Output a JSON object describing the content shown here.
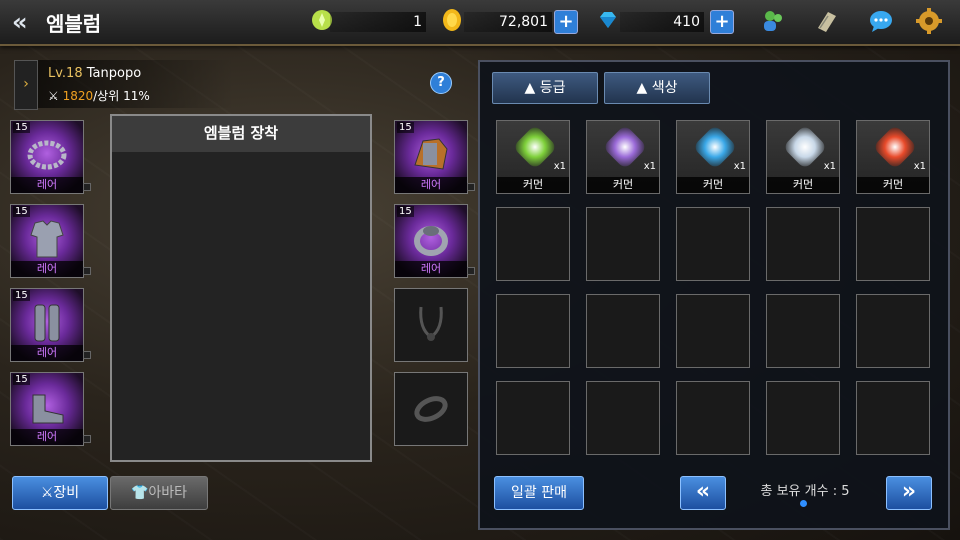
{
  "header": {
    "title": "엠블럼",
    "stamina_value": "1",
    "gold_value": "72,801",
    "gem_value": "410"
  },
  "character": {
    "level": "Lv.18",
    "name": "Tanpopo",
    "power": "1820",
    "rank": "/상위 11%"
  },
  "equipment": {
    "left_slots": [
      {
        "level": "15",
        "grade": "레어",
        "item": "necklace-chain"
      },
      {
        "level": "15",
        "grade": "레어",
        "item": "chest-armor"
      },
      {
        "level": "15",
        "grade": "레어",
        "item": "leg-armor"
      },
      {
        "level": "15",
        "grade": "레어",
        "item": "boots"
      }
    ],
    "right_slots": [
      {
        "level": "15",
        "grade": "레어",
        "item": "gauntlet"
      },
      {
        "level": "15",
        "grade": "레어",
        "item": "ring"
      },
      {
        "level": "",
        "grade": "",
        "item": "empty-necklace"
      },
      {
        "level": "",
        "grade": "",
        "item": "empty-ring"
      }
    ]
  },
  "emblem_panel": {
    "title": "엠블럼 장착"
  },
  "tabs": {
    "equip_label": "장비",
    "avatar_label": "아바타"
  },
  "inventory": {
    "filter_grade": "▲ 등급",
    "filter_color": "▲ 색상",
    "items": [
      {
        "grade": "커먼",
        "qty": "x1",
        "color": "#7ed03a"
      },
      {
        "grade": "커먼",
        "qty": "x1",
        "color": "#9a6ad8"
      },
      {
        "grade": "커먼",
        "qty": "x1",
        "color": "#3aa8e8"
      },
      {
        "grade": "커먼",
        "qty": "x1",
        "color": "#c8d8e8"
      },
      {
        "grade": "커먼",
        "qty": "x1",
        "color": "#e84a2a"
      }
    ],
    "sell_all_label": "일괄 판매",
    "total_count_label": "총 보유 개수 : 5",
    "prev_label": "«",
    "next_label": "»"
  },
  "colors": {
    "rare": "#d07aff",
    "button_blue": "#2f7fd8",
    "gold": "#f0a020"
  }
}
